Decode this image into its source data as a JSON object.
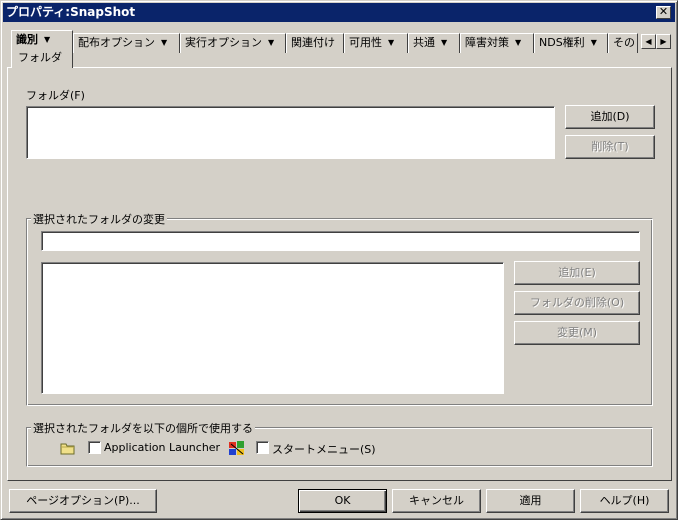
{
  "window": {
    "title": "プロパティ:SnapShot"
  },
  "tabs": [
    {
      "label": "識別",
      "sub": "フォルダ",
      "active": true
    },
    {
      "label": "配布オプション"
    },
    {
      "label": "実行オプション"
    },
    {
      "label": "関連付け"
    },
    {
      "label": "可用性"
    },
    {
      "label": "共通"
    },
    {
      "label": "障害対策"
    },
    {
      "label": "NDS権利"
    },
    {
      "label": "その"
    }
  ],
  "folder": {
    "label": "フォルダ(F)",
    "add_button": "追加(D)",
    "delete_button": "削除(T)"
  },
  "modify_group": {
    "title": "選択されたフォルダの変更",
    "name_value": "",
    "add_button": "追加(E)",
    "delete_folder_button": "フォルダの削除(O)",
    "change_button": "変更(M)"
  },
  "use_group": {
    "title": "選択されたフォルダを以下の個所で使用する",
    "app_launcher_label": "Application Launcher",
    "start_menu_label": "スタートメニュー(S)",
    "app_launcher_checked": false,
    "start_menu_checked": false
  },
  "footer": {
    "page_options": "ページオプション(P)...",
    "ok": "OK",
    "cancel": "キャンセル",
    "apply": "適用",
    "help": "ヘルプ(H)"
  }
}
